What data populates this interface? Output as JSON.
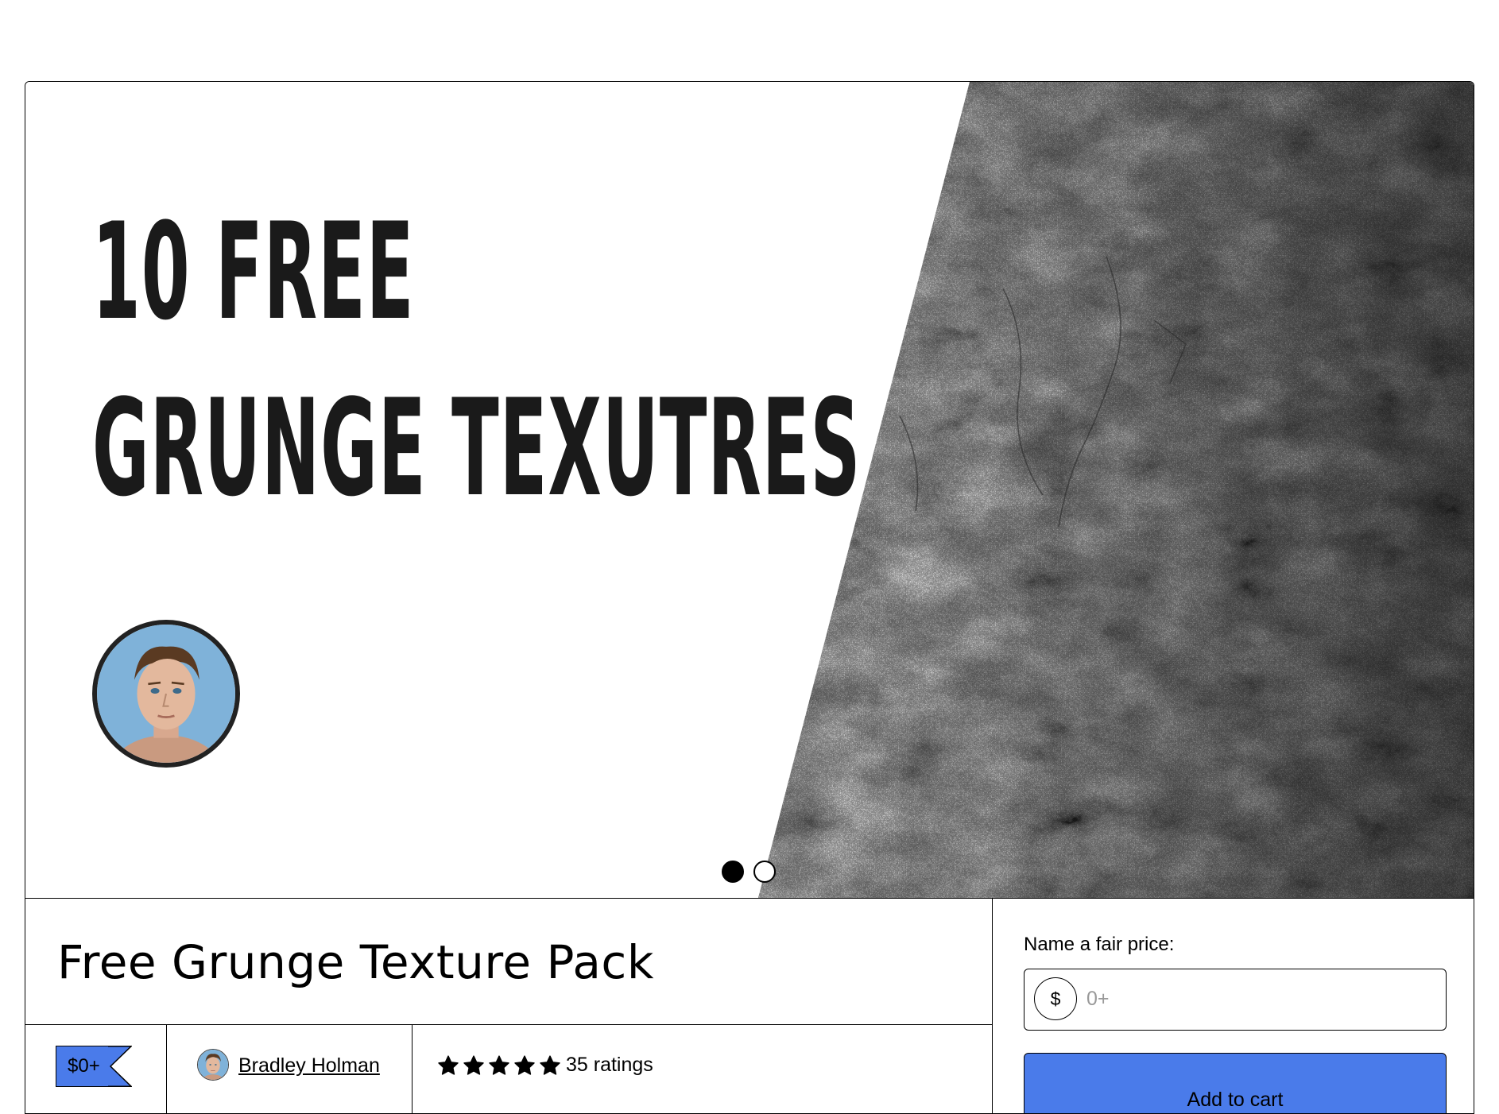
{
  "cover": {
    "headline_line1": "10 FREE",
    "headline_line2": "GRUNGE TEXUTRES",
    "carousel": {
      "slide_count": 2,
      "active_index": 0,
      "dot1_label": "Show slide 1",
      "dot2_label": "Show slide 2"
    }
  },
  "product": {
    "title": "Free Grunge Texture Pack",
    "price_badge": "$0+",
    "creator_name": "Bradley Holman",
    "rating_stars": 5,
    "ratings_label": "35 ratings"
  },
  "purchase": {
    "price_label": "Name a fair price:",
    "currency_symbol": "$",
    "price_placeholder": "0+",
    "price_value": "",
    "add_to_cart_label": "Add to cart"
  },
  "colors": {
    "accent": "#4a7bea",
    "border": "#000000",
    "headline": "#1a1a1a"
  },
  "icons": {
    "star": "star-icon",
    "price_tag": "price-tag-icon",
    "avatar": "avatar"
  }
}
